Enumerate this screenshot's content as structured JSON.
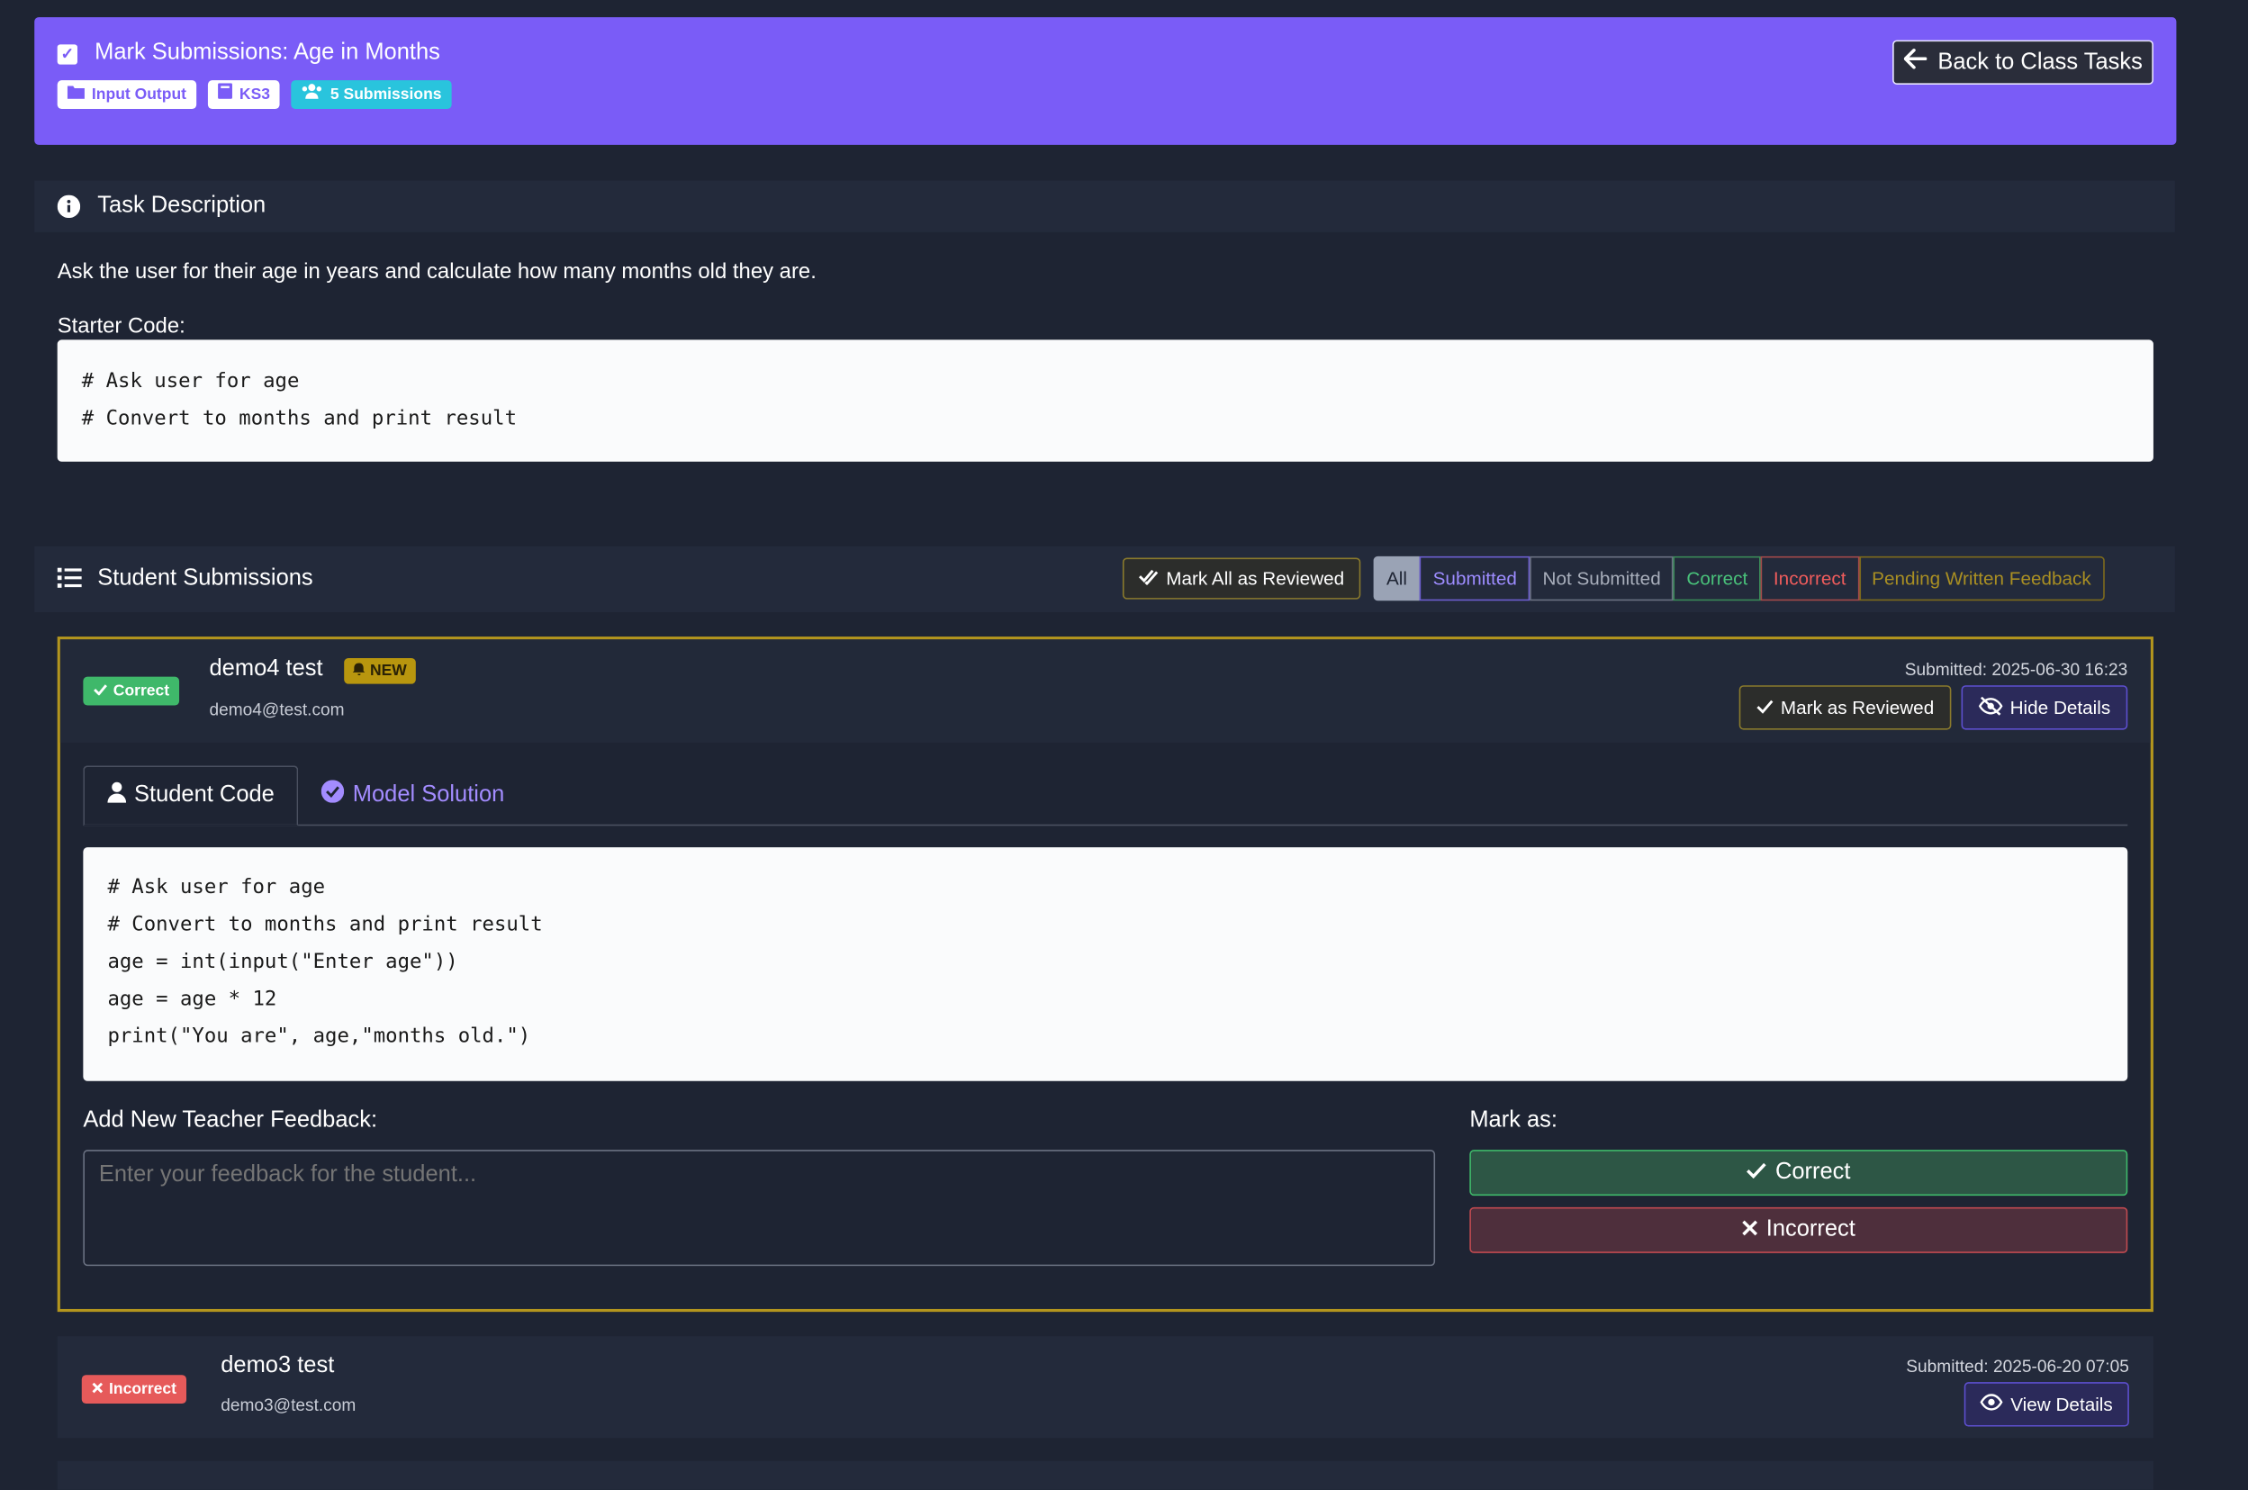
{
  "header": {
    "title": "Mark Submissions: Age in Months",
    "badges": [
      "Input Output",
      "KS3",
      "5 Submissions"
    ],
    "back_label": "Back to Class Tasks"
  },
  "task": {
    "section_title": "Task Description",
    "description": "Ask the user for their age in years and calculate how many months old they are.",
    "starter_label": "Starter Code:",
    "starter_code": [
      "# Ask user for age",
      "# Convert to months and print result"
    ]
  },
  "submissions_section": {
    "title": "Student Submissions",
    "mark_all_label": "Mark All as Reviewed",
    "filters": [
      "All",
      "Submitted",
      "Not Submitted",
      "Correct",
      "Incorrect",
      "Pending Written Feedback"
    ]
  },
  "submission1": {
    "status": "Correct",
    "name": "demo4 test",
    "new_badge": "NEW",
    "email": "demo4@test.com",
    "submitted": "Submitted: 2025-06-30 16:23",
    "mark_reviewed_label": "Mark as Reviewed",
    "hide_details_label": "Hide Details",
    "tab_student": "Student Code",
    "tab_model": "Model Solution",
    "code": [
      "# Ask user for age",
      "# Convert to months and print result",
      "age = int(input(\"Enter age\"))",
      "age = age * 12",
      "print(\"You are\", age,\"months old.\")"
    ],
    "feedback_label": "Add New Teacher Feedback:",
    "feedback_placeholder": "Enter your feedback for the student...",
    "mark_as_label": "Mark as:",
    "correct_label": "Correct",
    "incorrect_label": "Incorrect"
  },
  "submission2": {
    "status": "Incorrect",
    "name": "demo3 test",
    "email": "demo3@test.com",
    "submitted": "Submitted: 2025-06-20 07:05",
    "view_details_label": "View Details"
  },
  "colors": {
    "header_bg": "#7a5cf7",
    "page_bg": "#1e2433",
    "correct": "#3fb86a",
    "incorrect": "#e65a5a",
    "accent_gold": "#b3951e"
  }
}
